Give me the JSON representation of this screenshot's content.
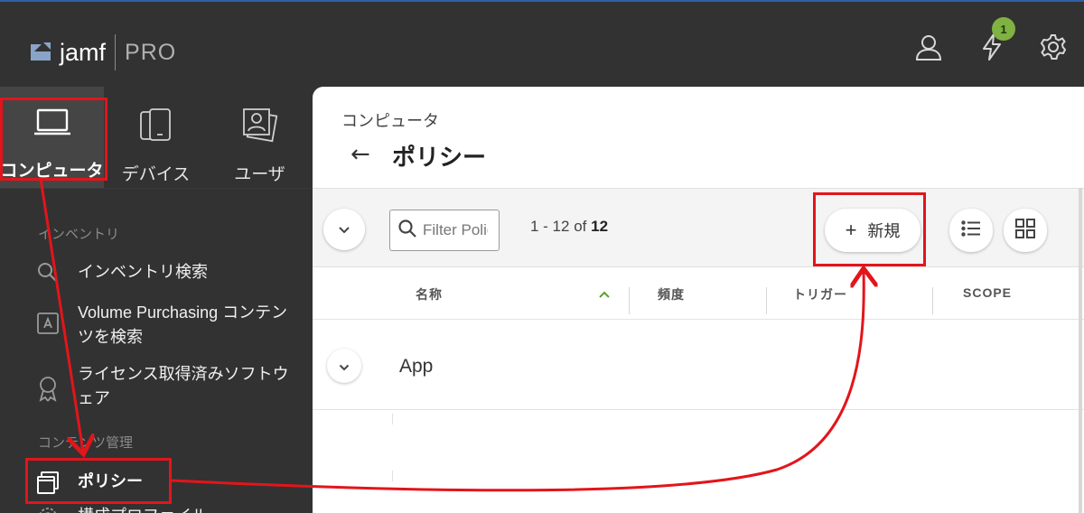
{
  "app": {
    "brand": "jamf",
    "product": "PRO",
    "notification_count": "1"
  },
  "nav_tabs": [
    {
      "label": "コンピュータ",
      "icon": "laptop-icon",
      "active": true
    },
    {
      "label": "デバイス",
      "icon": "mobile-devices-icon",
      "active": false
    },
    {
      "label": "ユーザ",
      "icon": "users-icon",
      "active": false
    }
  ],
  "sidebar": {
    "section_inventory": "インベントリ",
    "items": [
      {
        "label": "インベントリ検索",
        "icon": "search-icon"
      },
      {
        "label_line1": "Volume Purchasing コンテン",
        "label_line2": "ツを検索",
        "icon": "app-store-icon"
      },
      {
        "label_line1": "ライセンス取得済みソフトウ",
        "label_line2": "ェア",
        "icon": "license-award-icon"
      }
    ],
    "section_content": "コンテンツ管理",
    "active_item": {
      "label": "ポリシー",
      "icon": "policies-icon"
    },
    "next_item_partial": "構成プロファイル"
  },
  "main": {
    "breadcrumb": "コンピュータ",
    "back_glyph": "←",
    "title": "ポリシー",
    "search_placeholder": "Filter Policies",
    "count_prefix": "1 - 12 of ",
    "count_total": "12",
    "new_button_plus": "+",
    "new_button_label": "新規",
    "columns": [
      "名称",
      "頻度",
      "トリガー",
      "SCOPE"
    ],
    "rows": [
      {
        "name": "App"
      }
    ]
  },
  "colors": {
    "accent_red": "#e2151b",
    "badge_green": "#7fb241",
    "sort_arrow_green": "#5aa12e",
    "sidebar_bg": "#323232"
  }
}
